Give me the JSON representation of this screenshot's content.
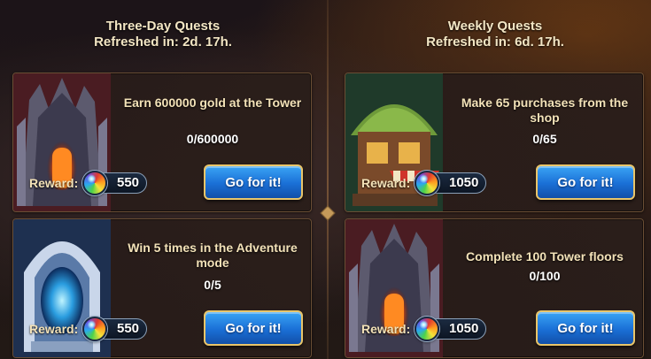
{
  "columns": [
    {
      "title": "Three-Day Quests",
      "refresh": "Refreshed in: 2d. 17h.",
      "quests": [
        {
          "title": "Earn 600000 gold at the Tower",
          "progress": "0/600000",
          "reward_label": "Reward:",
          "reward_amount": "550",
          "reward_icon": "rainbow-orb-icon",
          "button_label": "Go for it!",
          "art": "tower-gate-art"
        },
        {
          "title": "Win 5 times in the Adventure mode",
          "progress": "0/5",
          "reward_label": "Reward:",
          "reward_amount": "550",
          "reward_icon": "rainbow-orb-icon",
          "button_label": "Go for it!",
          "art": "portal-art"
        }
      ]
    },
    {
      "title": "Weekly Quests",
      "refresh": "Refreshed in: 6d. 17h.",
      "quests": [
        {
          "title": "Make 65 purchases from the shop",
          "progress": "0/65",
          "reward_label": "Reward:",
          "reward_amount": "1050",
          "reward_icon": "rainbow-orb-icon",
          "button_label": "Go for it!",
          "art": "shop-house-art"
        },
        {
          "title": "Complete 100 Tower floors",
          "progress": "0/100",
          "reward_label": "Reward:",
          "reward_amount": "1050",
          "reward_icon": "rainbow-orb-icon",
          "button_label": "Go for it!",
          "art": "tower-gate-art"
        }
      ]
    }
  ],
  "colors": {
    "button_blue": "#1a6fd6",
    "button_border": "#e9c56a",
    "title_text": "#f3e2b8",
    "card_border": "#6a4e34"
  }
}
